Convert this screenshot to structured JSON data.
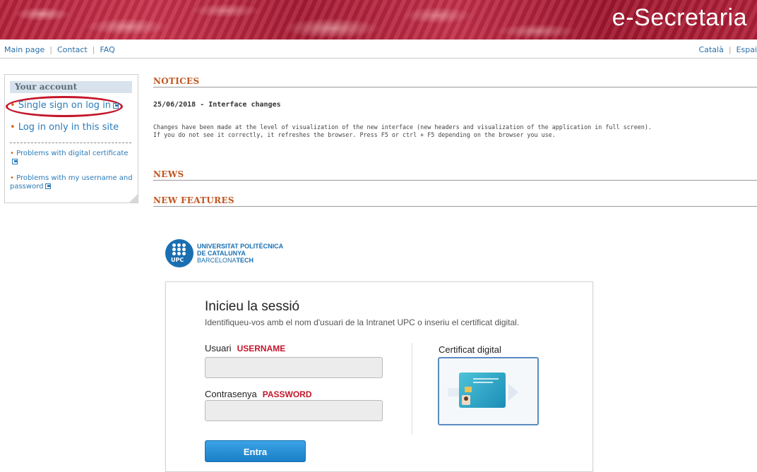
{
  "header": {
    "title": "e-Secretaria"
  },
  "topnav": {
    "links": [
      "Main page",
      "Contact",
      "FAQ"
    ],
    "languages": [
      "Català",
      "Espai"
    ]
  },
  "sidebar": {
    "heading": "Your account",
    "items": [
      {
        "label": "Single sign on log in",
        "external": true,
        "highlighted": true
      },
      {
        "label": "Log in only in this site",
        "external": false
      },
      {
        "label": "Problems with digital certificate",
        "external": true
      },
      {
        "label": "Problems with my username and password",
        "external": true
      }
    ]
  },
  "notices": {
    "title": "NOTICES",
    "date_heading": "25/06/2018 - Interface changes",
    "body_line1": "Changes have been made at the level of visualization of the new interface (new headers and visualization of the application in full screen).",
    "body_line2": "If you do not see it correctly, it refreshes the browser. Press F5 or ctrl + F5 depending on the browser you use."
  },
  "news": {
    "title": "NEWS"
  },
  "new_features": {
    "title": "NEW FEATURES"
  },
  "upc": {
    "logo_text": "UPC",
    "name_line1": "UNIVERSITAT POLITÈCNICA",
    "name_line2": "DE CATALUNYA",
    "name_line3a": "BARCELONA",
    "name_line3b": "TECH"
  },
  "login": {
    "title": "Inicieu la sessió",
    "subtitle": "Identifiqueu-vos amb el nom d'usuari de la Intranet UPC o inseriu el certificat digital.",
    "user_label": "Usuari",
    "user_annotation": "USERNAME",
    "user_value": "",
    "password_label": "Contrasenya",
    "password_annotation": "PASSWORD",
    "password_value": "",
    "cert_label": "Certificat digital",
    "submit_label": "Entra"
  },
  "colors": {
    "banner": "#b5223a",
    "section_title": "#c0561f",
    "link": "#2a7bb8",
    "annotation_red": "#c4162a",
    "button_blue": "#1a7fc6"
  }
}
